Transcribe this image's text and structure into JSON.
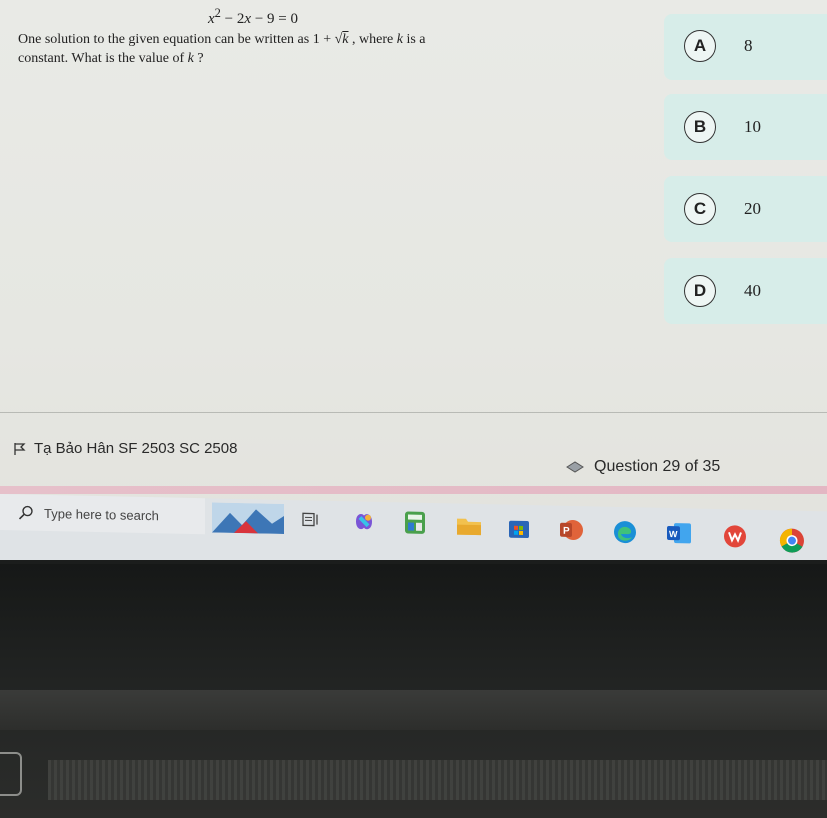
{
  "question": {
    "equation": {
      "x": "x",
      "sup": "2",
      "rest": " − 2",
      "x2": "x",
      "tail": " − 9 = 0"
    },
    "line1_a": "One solution to the given equation can be written as 1 + √",
    "line1_k": "k",
    "line1_b": " , where ",
    "line1_k2": "k",
    "line1_c": " is a",
    "line2_a": "constant. What is the value of ",
    "line2_k": "k",
    "line2_b": " ?"
  },
  "choices": [
    {
      "letter": "A",
      "value": "8"
    },
    {
      "letter": "B",
      "value": "10"
    },
    {
      "letter": "C",
      "value": "20"
    },
    {
      "letter": "D",
      "value": "40"
    }
  ],
  "footer": {
    "student_name": "Tạ Bảo Hân SF 2503 SC 2508",
    "progress": "Question 29 of 35"
  },
  "taskbar": {
    "search_placeholder": "Type here to search",
    "apps": [
      "news-widget-icon",
      "task-view-icon",
      "copilot-icon",
      "calculator-icon",
      "file-explorer-icon",
      "microsoft-store-icon",
      "powerpoint-icon",
      "edge-icon",
      "word-icon",
      "pdf-app-icon",
      "chrome-icon"
    ]
  },
  "colors": {
    "choice_panel": "#d7ede9",
    "screen_bg": "#e9eae6",
    "progress_bar": "#e3b7c3",
    "taskbar_bg": "#dfe3e6"
  }
}
